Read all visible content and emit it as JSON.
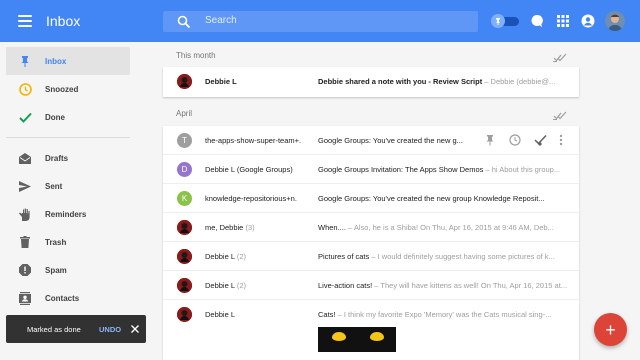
{
  "header": {
    "title": "Inbox",
    "search_placeholder": "Search",
    "brand_color": "#4285f4"
  },
  "sidebar": {
    "items": [
      {
        "label": "Inbox",
        "icon": "pin-icon",
        "active": true
      },
      {
        "label": "Snoozed",
        "icon": "clock-icon"
      },
      {
        "label": "Done",
        "icon": "check-icon"
      },
      {
        "label": "Drafts",
        "icon": "drafts-icon"
      },
      {
        "label": "Sent",
        "icon": "send-icon"
      },
      {
        "label": "Reminders",
        "icon": "hand-icon"
      },
      {
        "label": "Trash",
        "icon": "trash-icon"
      },
      {
        "label": "Spam",
        "icon": "spam-icon"
      },
      {
        "label": "Contacts",
        "icon": "contacts-icon"
      }
    ]
  },
  "sections": {
    "this_month": "This month",
    "april": "April"
  },
  "this_month_rows": [
    {
      "sender": "Debbie L",
      "count": "",
      "subject": "Debbie shared a note with you - Review Script",
      "snippet": " – Debbie (debbie@...",
      "avatar_color": "#8b1a1a",
      "bold": true
    }
  ],
  "april_rows": [
    {
      "sender": "the-apps-show-super-team+.",
      "count": "",
      "subject": "Google Groups: You've created the new g...",
      "snippet": "",
      "avatar_letter": "T",
      "avatar_color": "#9e9e9e"
    },
    {
      "sender": "Debbie L (Google Groups)",
      "count": "",
      "subject": "Google Groups Invitation: The Apps Show Demos",
      "snippet": " – hi About this group...",
      "avatar_letter": "D",
      "avatar_color": "#9575cd"
    },
    {
      "sender": "knowledge-repositorious+n.",
      "count": "",
      "subject": "Google Groups: You've created the new group Knowledge Reposit...",
      "snippet": "",
      "avatar_letter": "K",
      "avatar_color": "#8bc34a"
    },
    {
      "sender": "me, Debbie",
      "count": "(3)",
      "subject": "When....",
      "snippet": " – Also, he is a Shiba! On Thu, Apr 16, 2015 at 9:46 AM, Deb...",
      "avatar_letter": "",
      "avatar_color": "#8b1a1a"
    },
    {
      "sender": "Debbie L",
      "count": "(2)",
      "subject": "Pictures of cats",
      "snippet": " – I would definitely suggest having some pictures of k...",
      "avatar_letter": "",
      "avatar_color": "#8b1a1a"
    },
    {
      "sender": "Debbie L",
      "count": "(2)",
      "subject": "Live-action cats!",
      "snippet": " – They will have kittens as well! On Thu, Apr 16, 2015 at...",
      "avatar_letter": "",
      "avatar_color": "#8b1a1a"
    },
    {
      "sender": "Debbie L",
      "count": "",
      "subject": "Cats!",
      "snippet": " – I think my favorite Expo 'Memory' was the Cats musical sing-...",
      "avatar_letter": "",
      "avatar_color": "#8b1a1a"
    }
  ],
  "snackbar": {
    "text": "Marked as done",
    "action": "UNDO"
  },
  "fab": {
    "color": "#db4437"
  }
}
